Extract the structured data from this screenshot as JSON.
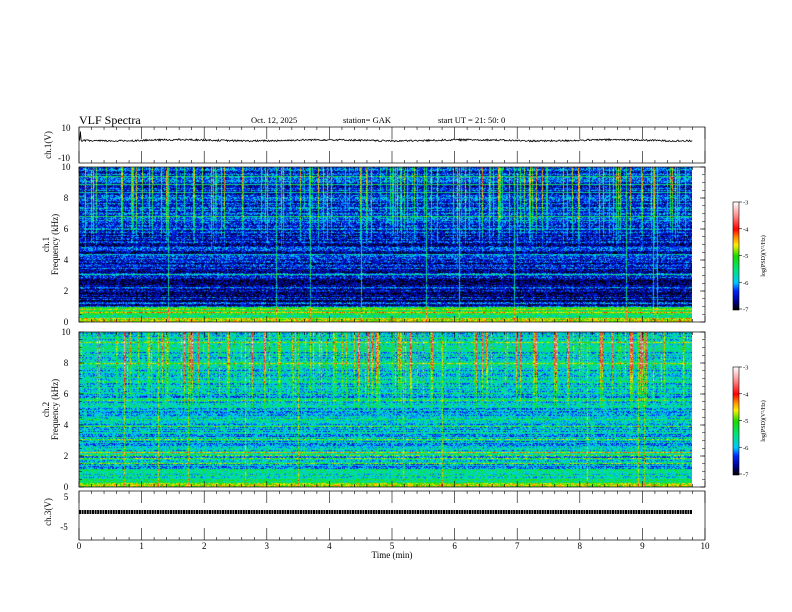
{
  "header": {
    "title": "VLF  Spectra",
    "date": "Oct. 12, 2025",
    "station": "station= GAK",
    "start_ut": "start  UT  =    21: 50: 0"
  },
  "chart_data": [
    {
      "type": "line",
      "name": "ch1-waveform",
      "ylabel": "ch.1(V)",
      "ylim": [
        -10,
        10
      ],
      "yticks": [
        "10",
        "-10"
      ],
      "description_values": {
        "baseline_v": 1.5,
        "noise_v": 1.0
      },
      "xlim": [
        0,
        10
      ],
      "data_xmax": 9.8
    },
    {
      "type": "heatmap",
      "name": "ch1-spectrogram",
      "ylabel": "ch.1\nFrequency (kHz)",
      "ylabel_lines": [
        "ch.1",
        "Frequency  (kHz)"
      ],
      "ylim": [
        0,
        10
      ],
      "yticks": [
        "0",
        "2",
        "4",
        "6",
        "8",
        "10"
      ],
      "colorbar": {
        "label": "log(PSD)(V²/Hz)",
        "range": [
          -7,
          -3
        ],
        "ticks": [
          "-3",
          "-4",
          "-5",
          "-6",
          "-7"
        ]
      }
    },
    {
      "type": "heatmap",
      "name": "ch2-spectrogram",
      "ylabel_lines": [
        "ch.2",
        "Frequency  (kHz)"
      ],
      "ylim": [
        0,
        10
      ],
      "yticks": [
        "0",
        "2",
        "4",
        "6",
        "8",
        "10"
      ],
      "colorbar": {
        "label": "log(PSD)(V²/Hz)",
        "range": [
          -7,
          -3
        ],
        "ticks": [
          "-3",
          "-4",
          "-5",
          "-6",
          "-7"
        ]
      }
    },
    {
      "type": "line",
      "name": "ch3-waveform",
      "ylabel": "ch.3(V)",
      "ylim": [
        -5,
        5
      ],
      "yticks": [
        "5",
        "-5"
      ],
      "description_values": {
        "baseline_v": 0
      }
    }
  ],
  "xaxis": {
    "label": "Time  (min)",
    "range": [
      0,
      10
    ],
    "ticks": [
      "0",
      "1",
      "2",
      "3",
      "4",
      "5",
      "6",
      "7",
      "8",
      "9",
      "10"
    ]
  }
}
